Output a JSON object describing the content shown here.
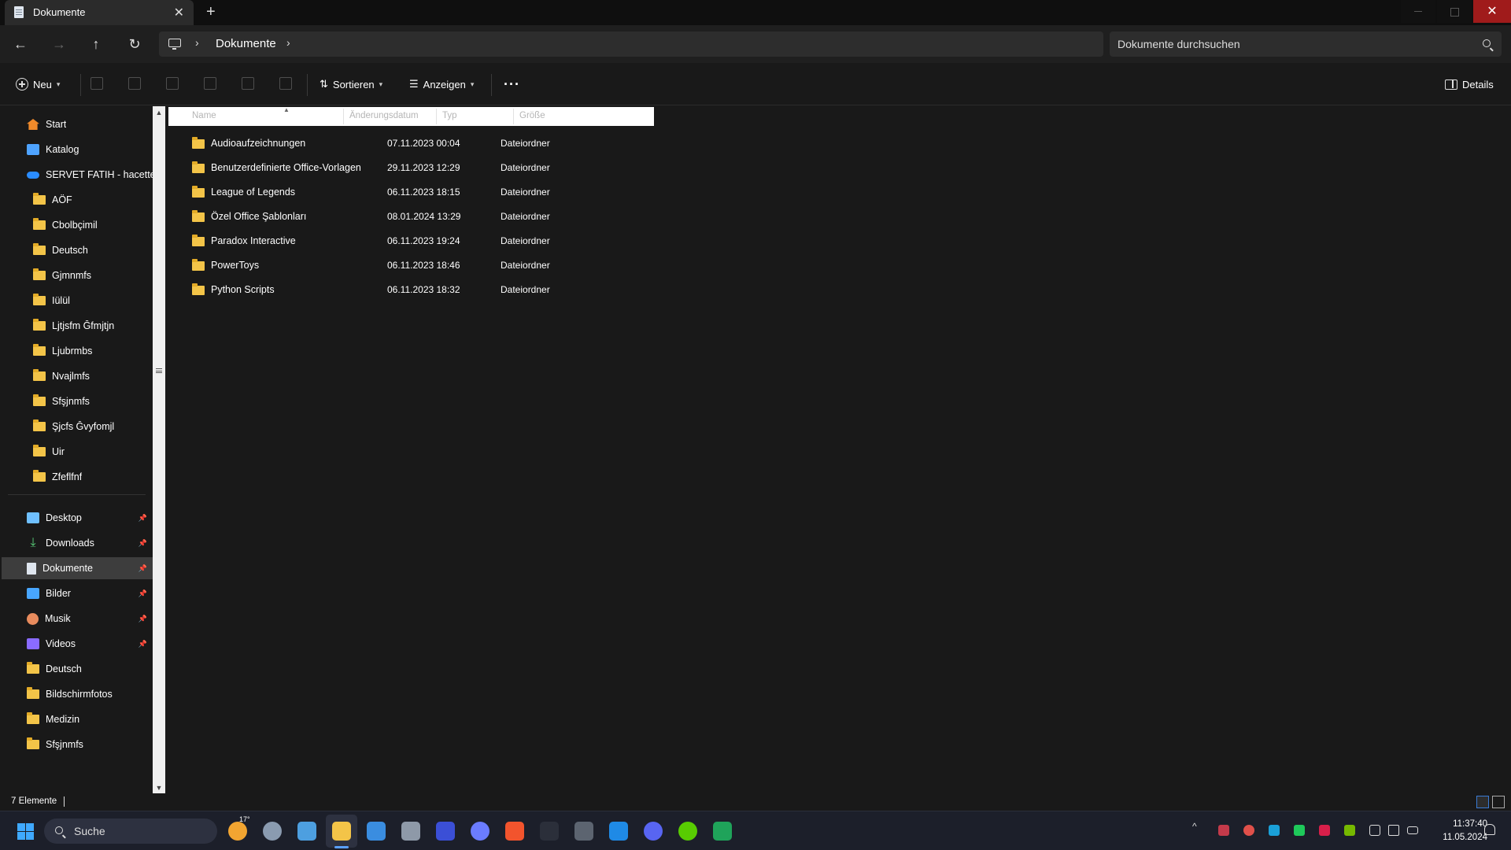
{
  "window": {
    "tab_title": "Dokumente",
    "close_glyph": "✕",
    "add_tab_glyph": "+"
  },
  "address": {
    "crumb": "Dokumente",
    "search_placeholder": "Dokumente durchsuchen"
  },
  "toolbar": {
    "new_label": "Neu",
    "sort_label": "Sortieren",
    "view_label": "Anzeigen",
    "more_label": "···",
    "details_label": "Details"
  },
  "sidebar": {
    "top": [
      {
        "label": "Start",
        "icon": "home-icon"
      },
      {
        "label": "Katalog",
        "icon": "gallery-icon"
      },
      {
        "label": "SERVET FATIH - hacettepe.",
        "icon": "cloud-icon"
      }
    ],
    "cloud_folders": [
      "AÖF",
      "Cbolbçimil",
      "Deutsch",
      "Gjmnmfs",
      "Iülül",
      "Ljtjsfm Ğfmjtjn",
      "Ljubrmbs",
      "Nvajlmfs",
      "Sfşjnmfs",
      "Şjcfs Ğvyfomjl",
      "Uir",
      "Zfeflfnf"
    ],
    "quick_access": [
      {
        "label": "Desktop",
        "icon": "desktop-icon",
        "pinned": true
      },
      {
        "label": "Downloads",
        "icon": "download-icon",
        "pinned": true
      },
      {
        "label": "Dokumente",
        "icon": "document-icon",
        "pinned": true,
        "selected": true
      },
      {
        "label": "Bilder",
        "icon": "pictures-icon",
        "pinned": true
      },
      {
        "label": "Musik",
        "icon": "music-icon",
        "pinned": true
      },
      {
        "label": "Videos",
        "icon": "videos-icon",
        "pinned": true
      },
      {
        "label": "Deutsch",
        "icon": "folder-icon",
        "pinned": false
      },
      {
        "label": "Bildschirmfotos",
        "icon": "folder-icon",
        "pinned": false
      },
      {
        "label": "Medizin",
        "icon": "folder-icon",
        "pinned": false
      },
      {
        "label": "Sfşjnmfs",
        "icon": "folder-icon",
        "pinned": false
      }
    ]
  },
  "files": {
    "columns": [
      "Name",
      "Änderungsdatum",
      "Typ",
      "Größe"
    ],
    "rows": [
      {
        "name": "Audioaufzeichnungen",
        "date": "07.11.2023 00:04",
        "type": "Dateiordner"
      },
      {
        "name": "Benutzerdefinierte Office-Vorlagen",
        "date": "29.11.2023 12:29",
        "type": "Dateiordner"
      },
      {
        "name": "League of Legends",
        "date": "06.11.2023 18:15",
        "type": "Dateiordner"
      },
      {
        "name": "Özel Office Şablonları",
        "date": "08.01.2024 13:29",
        "type": "Dateiordner"
      },
      {
        "name": "Paradox Interactive",
        "date": "06.11.2023 19:24",
        "type": "Dateiordner"
      },
      {
        "name": "PowerToys",
        "date": "06.11.2023 18:46",
        "type": "Dateiordner"
      },
      {
        "name": "Python Scripts",
        "date": "06.11.2023 18:32",
        "type": "Dateiordner"
      }
    ]
  },
  "status": {
    "count": "7 Elemente"
  },
  "taskbar": {
    "search_label": "Suche",
    "weather_badge": "17°",
    "time": "11:37:40",
    "date": "11.05.2024",
    "tray_arrow": "^"
  },
  "colors": {
    "folder": "#f3c448",
    "accent": "#3fa9ff",
    "close_button": "#a01b1b"
  }
}
